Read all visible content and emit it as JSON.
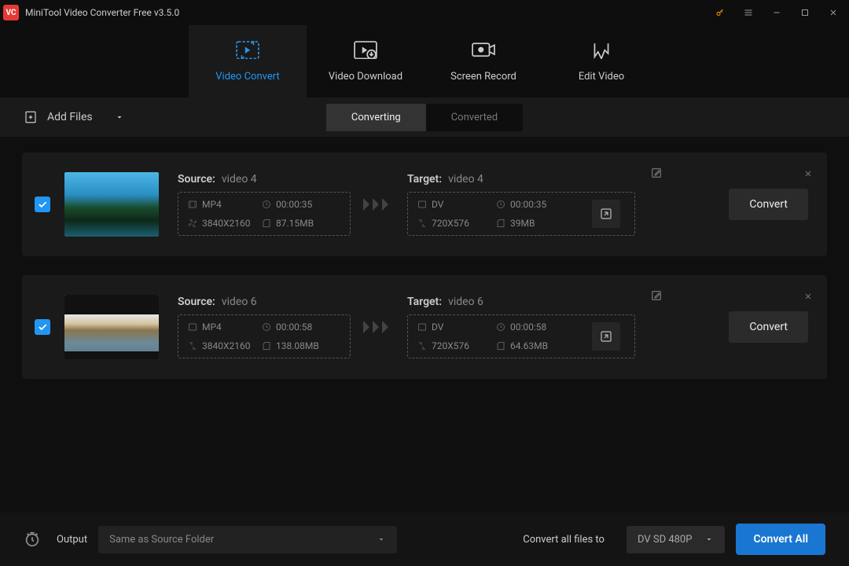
{
  "app": {
    "title": "MiniTool Video Converter Free v3.5.0"
  },
  "tabs": [
    {
      "label": "Video Convert"
    },
    {
      "label": "Video Download"
    },
    {
      "label": "Screen Record"
    },
    {
      "label": "Edit Video"
    }
  ],
  "toolbar": {
    "add_files": "Add Files"
  },
  "segment": {
    "converting": "Converting",
    "converted": "Converted"
  },
  "labels": {
    "source": "Source:",
    "target": "Target:"
  },
  "items": [
    {
      "source_name": "video 4",
      "source": {
        "format": "MP4",
        "duration": "00:00:35",
        "resolution": "3840X2160",
        "size": "87.15MB"
      },
      "target_name": "video 4",
      "target": {
        "format": "DV",
        "duration": "00:00:35",
        "resolution": "720X576",
        "size": "39MB"
      },
      "convert": "Convert"
    },
    {
      "source_name": "video 6",
      "source": {
        "format": "MP4",
        "duration": "00:00:58",
        "resolution": "3840X2160",
        "size": "138.08MB"
      },
      "target_name": "video 6",
      "target": {
        "format": "DV",
        "duration": "00:00:58",
        "resolution": "720X576",
        "size": "64.63MB"
      },
      "convert": "Convert"
    }
  ],
  "footer": {
    "output_label": "Output",
    "output_path": "Same as Source Folder",
    "convert_all_label": "Convert all files to",
    "format": "DV SD 480P",
    "convert_all": "Convert All"
  }
}
